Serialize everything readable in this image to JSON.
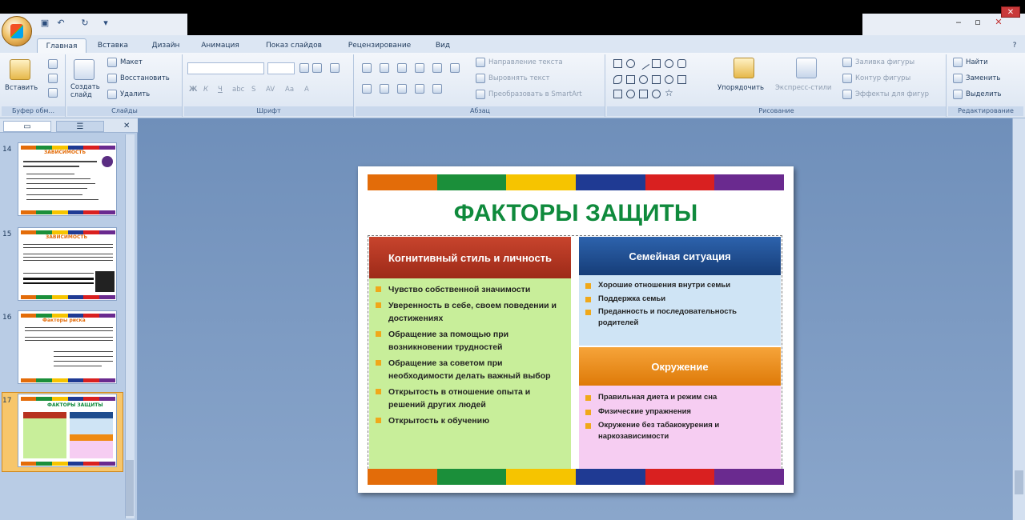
{
  "ribbon": {
    "tabs": [
      "Главная",
      "Вставка",
      "Дизайн",
      "Анимация",
      "Показ слайдов",
      "Рецензирование",
      "Вид"
    ],
    "clipboard": {
      "paste": "Вставить",
      "label": "Буфер обм..."
    },
    "slides": {
      "new_slide": "Создать слайд",
      "layout": "Макет",
      "reset": "Восстановить",
      "delete": "Удалить",
      "label": "Слайды"
    },
    "font": {
      "label": "Шрифт"
    },
    "paragraph": {
      "text_direction": "Направление текста",
      "align_text": "Выровнять текст",
      "smartart": "Преобразовать в SmartArt",
      "label": "Абзац"
    },
    "drawing": {
      "arrange": "Упорядочить",
      "quick_styles": "Экспресс-стили",
      "shape_fill": "Заливка фигуры",
      "shape_outline": "Контур фигуры",
      "shape_effects": "Эффекты для фигур",
      "label": "Рисование"
    },
    "editing": {
      "find": "Найти",
      "replace": "Заменить",
      "select": "Выделить",
      "label": "Редактирование"
    }
  },
  "pane": {
    "tab_slides": "Слайды",
    "tab_outline": "Структура",
    "thumbs": [
      {
        "num": "14",
        "title": "ЗАВИСИМОСТЬ"
      },
      {
        "num": "15",
        "title": "ЗАВИСИМОСТЬ"
      },
      {
        "num": "16",
        "title": "Факторы риска"
      },
      {
        "num": "17",
        "title": "ФАКТОРЫ ЗАЩИТЫ"
      }
    ]
  },
  "slide": {
    "title": "ФАКТОРЫ ЗАЩИТЫ",
    "stripe_colors": [
      "#e36c09",
      "#1b8f3a",
      "#f6c400",
      "#1f3a93",
      "#d92020",
      "#6a2a8f"
    ],
    "cognitive": {
      "header": "Когнитивный стиль и личность",
      "items": [
        "Чувство собственной значимости",
        "Уверенность в себе, своем поведении и достижениях",
        "Обращение за помощью при возникновении трудностей",
        "Обращение за советом при необходимости делать важный выбор",
        "Открытость в отношение опыта и решений других людей",
        "Открытость к обучению"
      ]
    },
    "family": {
      "header": "Семейная ситуация",
      "items": [
        "Хорошие отношения внутри семьи",
        "Поддержка семьи",
        "Преданность и последовательность родителей"
      ]
    },
    "environment": {
      "header": "Окружение",
      "items": [
        "Правильная диета и режим сна",
        "Физические упражнения",
        "Окружение без табакокурения и наркозависимости"
      ]
    }
  },
  "colors": {
    "title_green": "#0f8a3c",
    "red_header": "#b7311f",
    "blue_header": "#1f4d8f",
    "orange_header": "#ef8a12",
    "green_panel": "#c8ee9a",
    "blue_panel": "#cfe4f5",
    "pink_panel": "#f6cdf2"
  }
}
